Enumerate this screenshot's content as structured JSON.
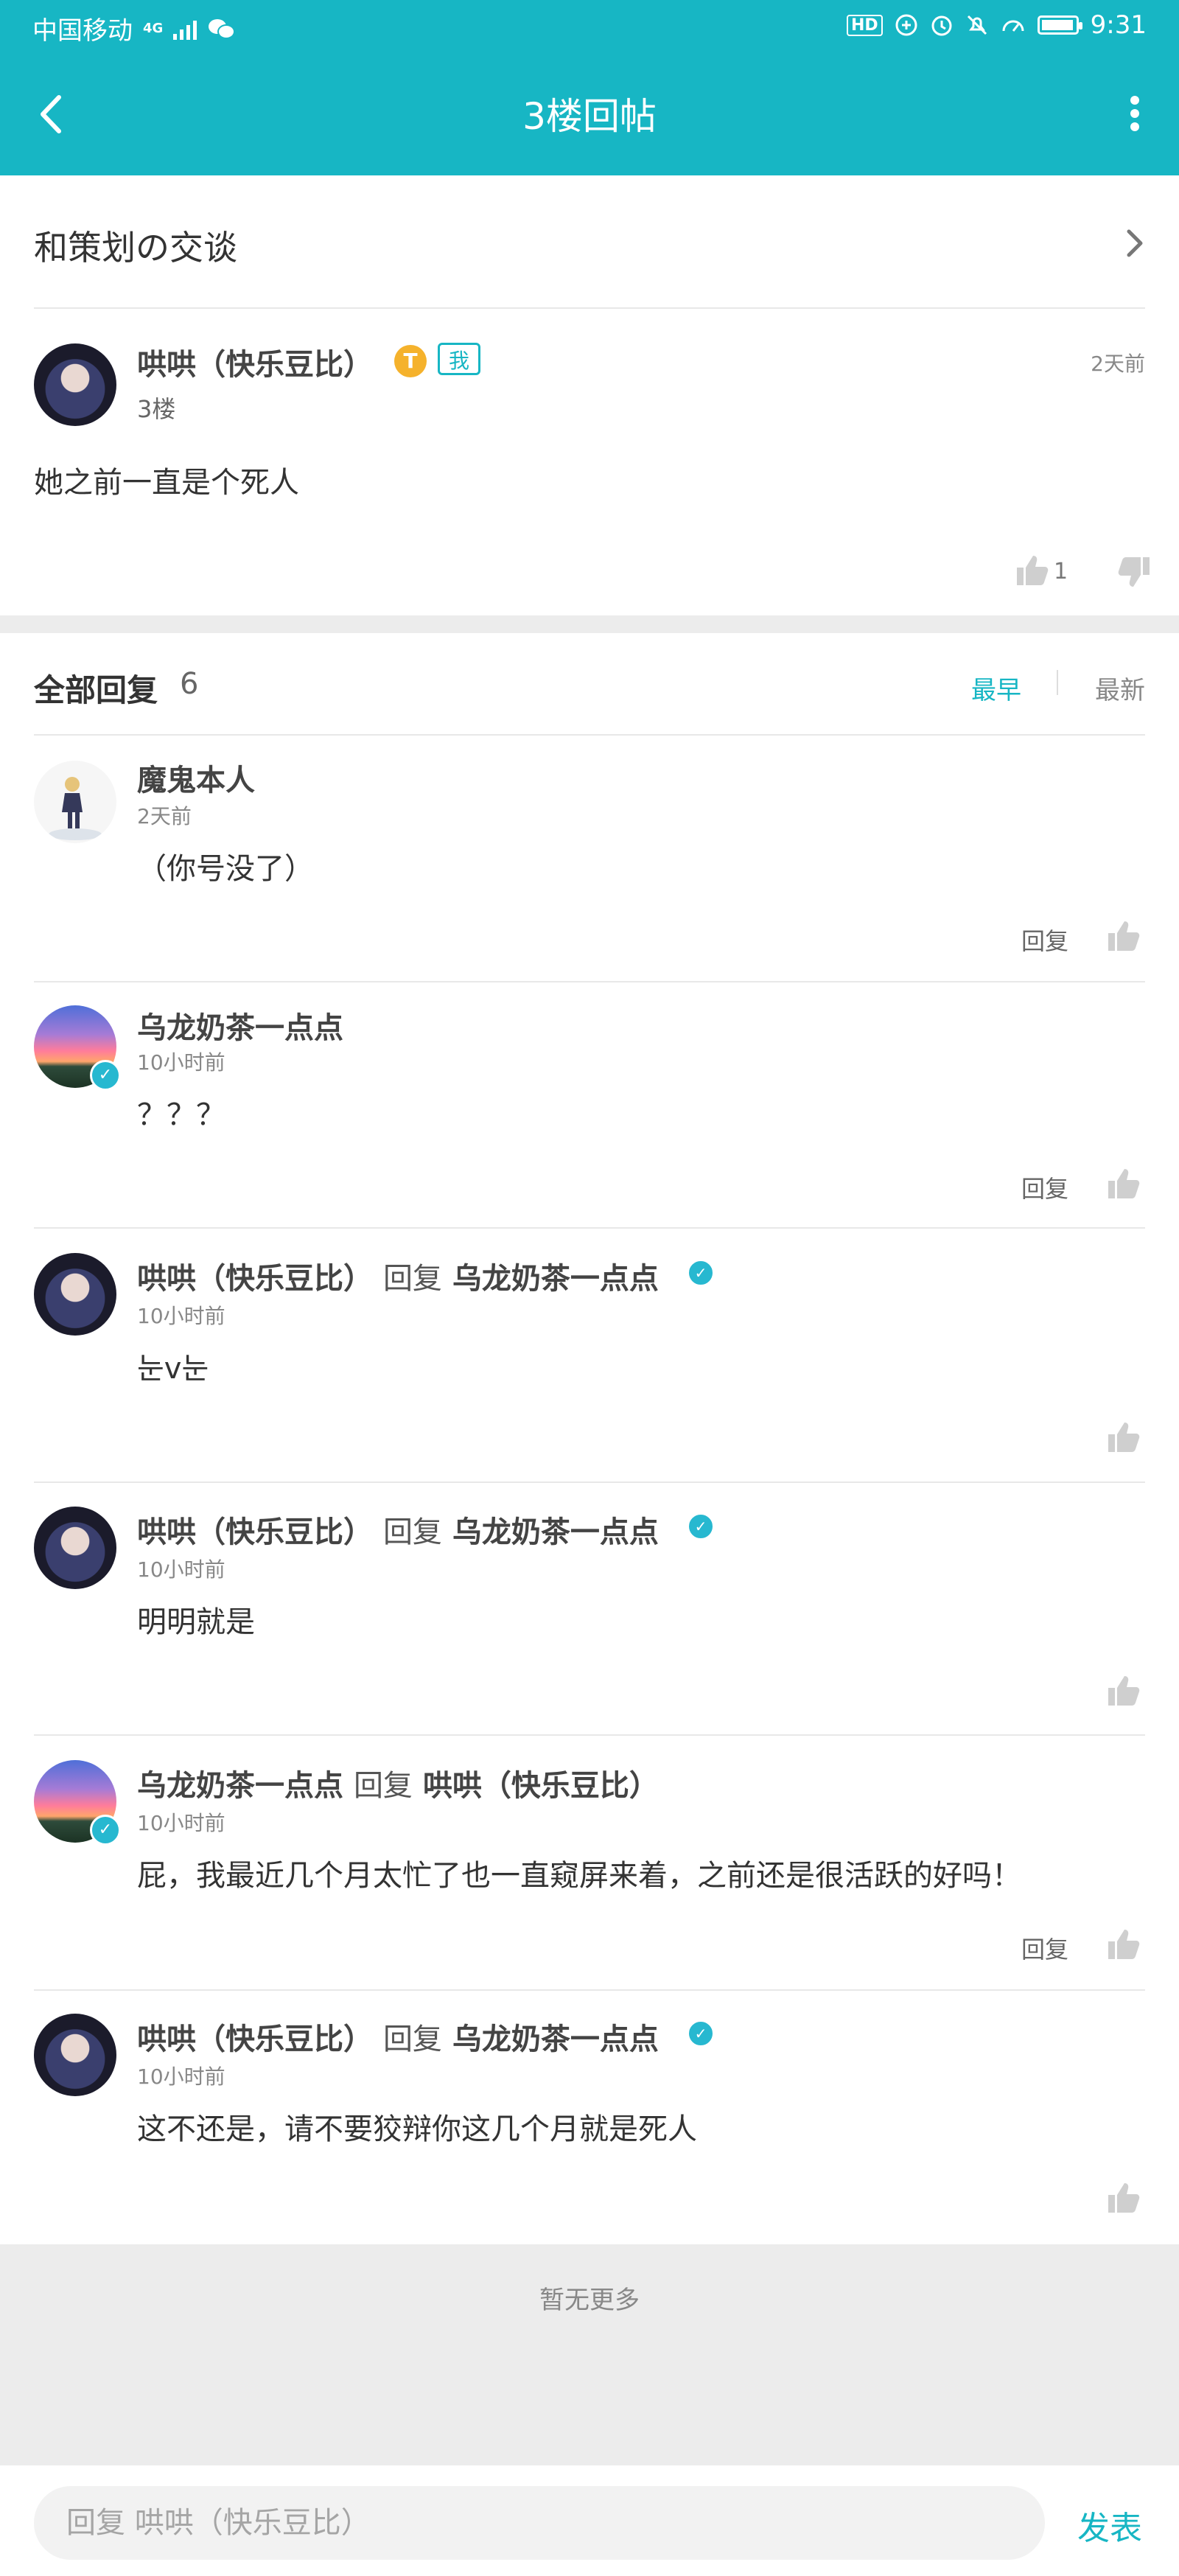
{
  "status_bar": {
    "carrier": "中国移动",
    "network": "4G",
    "time": "9:31",
    "hd": "HD"
  },
  "header": {
    "title": "3楼回帖"
  },
  "thread": {
    "title": "和策划の交谈"
  },
  "post": {
    "author": "哄哄（快乐豆比）",
    "level_badge": "T",
    "me_badge": "我",
    "floor": "3楼",
    "time": "2天前",
    "content": "她之前一直是个死人",
    "likes": "1"
  },
  "replies_header": {
    "title": "全部回复",
    "count": "6",
    "sort_earliest": "最早",
    "sort_latest": "最新"
  },
  "replies": [
    {
      "author": "魔鬼本人",
      "time": "2天前",
      "content": "（你号没了）",
      "reply_label": "回复"
    },
    {
      "author": "乌龙奶茶一点点",
      "time": "10小时前",
      "content": "？？？",
      "reply_label": "回复"
    },
    {
      "author": "哄哄（快乐豆比）",
      "reply_word": "回复",
      "target": "乌龙奶茶一点点",
      "time": "10小时前",
      "content": "눈v눈"
    },
    {
      "author": "哄哄（快乐豆比）",
      "reply_word": "回复",
      "target": "乌龙奶茶一点点",
      "time": "10小时前",
      "content": "明明就是"
    },
    {
      "author": "乌龙奶茶一点点",
      "reply_word": "回复",
      "target": "哄哄（快乐豆比）",
      "time": "10小时前",
      "content": "屁，我最近几个月太忙了也一直窥屏来着，之前还是很活跃的好吗！",
      "reply_label": "回复"
    },
    {
      "author": "哄哄（快乐豆比）",
      "reply_word": "回复",
      "target": "乌龙奶茶一点点",
      "time": "10小时前",
      "content": "这不还是，请不要狡辩你这几个月就是死人"
    }
  ],
  "footer": {
    "no_more": "暂无更多",
    "input_placeholder": "回复 哄哄（快乐豆比）",
    "send_label": "发表"
  },
  "colors": {
    "accent": "#17b6c4",
    "band": "#ececec"
  }
}
